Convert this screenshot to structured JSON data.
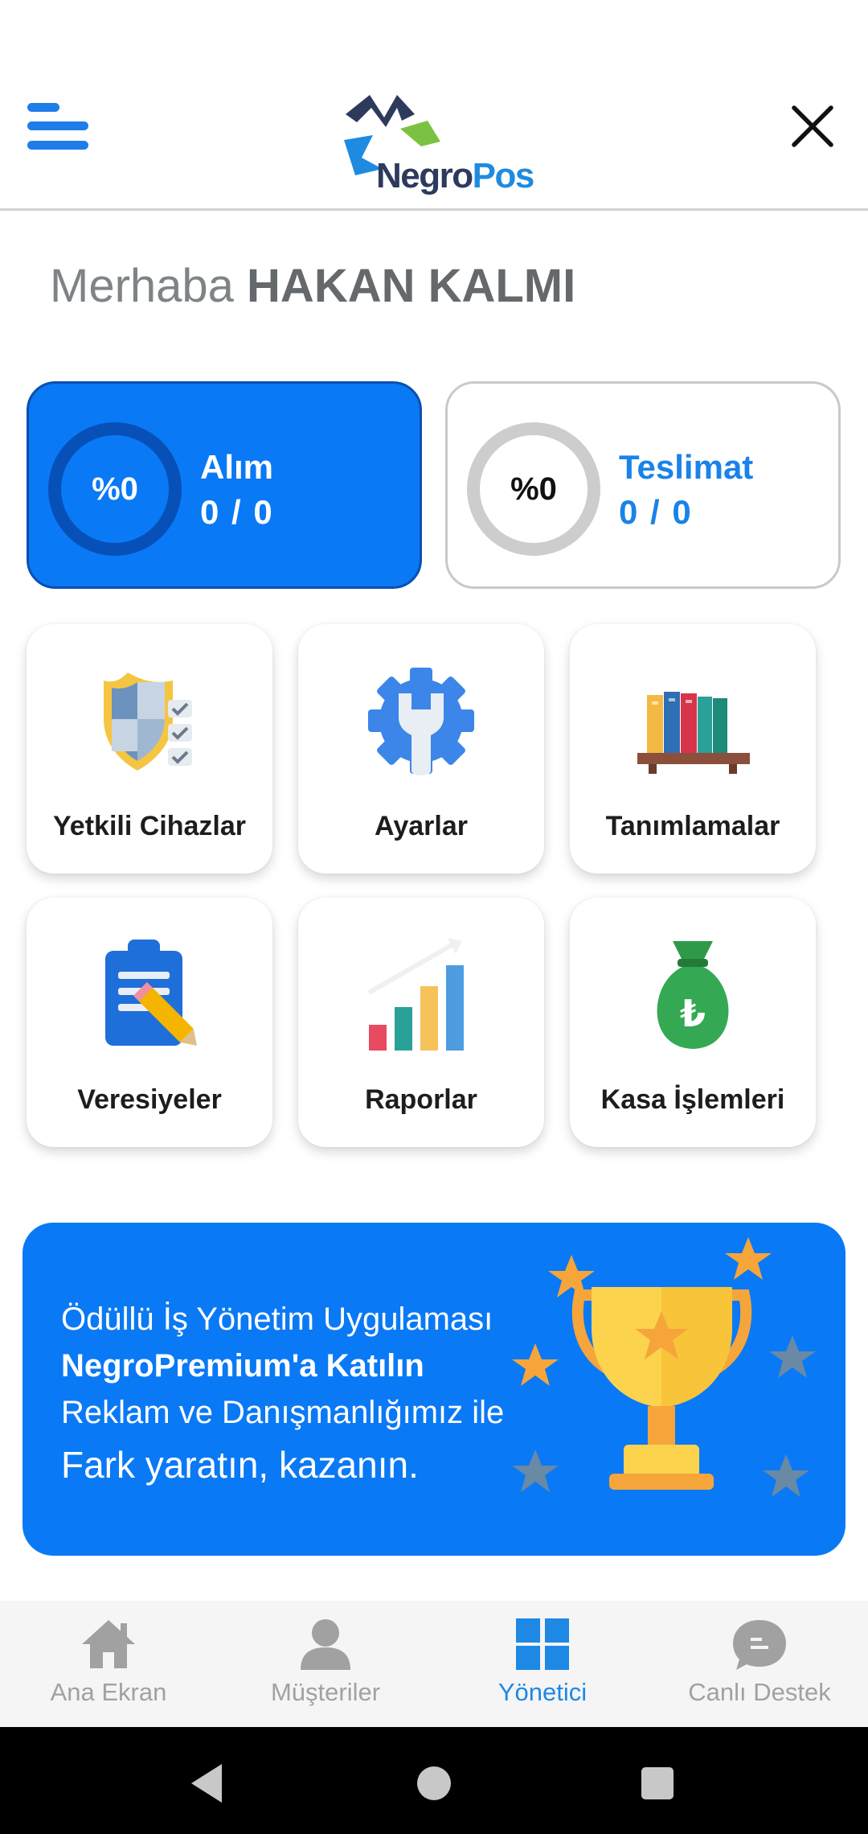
{
  "header": {
    "logo_part1": "Negro",
    "logo_part2": "Pos"
  },
  "greeting": {
    "prefix": "Merhaba",
    "name": "HAKAN KALMI"
  },
  "stats": {
    "alim": {
      "percent_text": "%0",
      "title": "Alım",
      "value": "0 / 0",
      "progress": 0
    },
    "teslimat": {
      "percent_text": "%0",
      "title": "Teslimat",
      "value": "0 / 0",
      "progress": 0
    }
  },
  "tiles": [
    {
      "label": "Yetkili Cihazlar",
      "icon": "shield-check-icon"
    },
    {
      "label": "Ayarlar",
      "icon": "gear-wrench-icon"
    },
    {
      "label": "Tanımlamalar",
      "icon": "bookshelf-icon"
    },
    {
      "label": "Veresiyeler",
      "icon": "clipboard-pencil-icon"
    },
    {
      "label": "Raporlar",
      "icon": "bar-chart-icon"
    },
    {
      "label": "Kasa İşlemleri",
      "icon": "money-bag-icon"
    }
  ],
  "promo": {
    "line1": "Ödüllü İş Yönetim Uygulaması",
    "line2": "NegroPremium'a Katılın",
    "line3": "Reklam ve Danışmanlığımız ile",
    "line4": "Fark yaratın, kazanın."
  },
  "nav": {
    "items": [
      {
        "label": "Ana Ekran",
        "icon": "home-icon"
      },
      {
        "label": "Müşteriler",
        "icon": "person-icon"
      },
      {
        "label": "Yönetici",
        "icon": "grid-icon"
      },
      {
        "label": "Canlı Destek",
        "icon": "chat-icon"
      }
    ],
    "active": "Yönetici"
  },
  "colors": {
    "accent": "#0a79f5",
    "active_nav": "#1e88e5",
    "inactive_nav": "#a1a1a1"
  }
}
